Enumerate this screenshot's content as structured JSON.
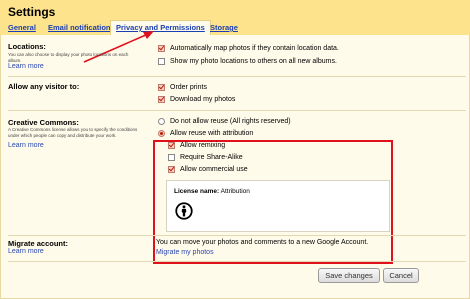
{
  "title": "Settings",
  "tabs": [
    {
      "label": "General"
    },
    {
      "label": "Email notification"
    },
    {
      "label": "Privacy and Permissions",
      "active": true
    },
    {
      "label": "Storage"
    }
  ],
  "locations": {
    "label": "Locations:",
    "desc": "You can also choose to display your photo locations on each album.",
    "learn_more": "Learn more",
    "options": [
      {
        "label": "Automatically map photos if they contain location data.",
        "checked": true
      },
      {
        "label": "Show my photo locations to others on all new albums.",
        "checked": false
      }
    ]
  },
  "visitor": {
    "label": "Allow any visitor to:",
    "options": [
      {
        "label": "Order prints",
        "checked": true
      },
      {
        "label": "Download my photos",
        "checked": true
      }
    ]
  },
  "cc": {
    "label": "Creative Commons:",
    "desc": "A Creative Commons license allows you to specify the conditions under which people can copy and distribute your work.",
    "learn_more": "Learn more",
    "radio_none": "Do not allow reuse (All rights reserved)",
    "radio_attr": "Allow reuse with attribution",
    "sub": [
      {
        "label": "Allow remixing",
        "checked": true
      },
      {
        "label": "Require Share-Alike",
        "checked": false
      },
      {
        "label": "Allow commercial use",
        "checked": true
      }
    ],
    "license_label": "License name:",
    "license_value": "Attribution"
  },
  "migrate": {
    "label": "Migrate account:",
    "learn_more": "Learn more",
    "text": "You can move your photos and comments to a new Google Account.",
    "link": "Migrate my photos"
  },
  "buttons": {
    "save": "Save changes",
    "cancel": "Cancel"
  },
  "colors": {
    "header": "#fde38b",
    "panel": "#fffbea",
    "link": "#1a3fb4",
    "highlight": "#e0101c"
  }
}
